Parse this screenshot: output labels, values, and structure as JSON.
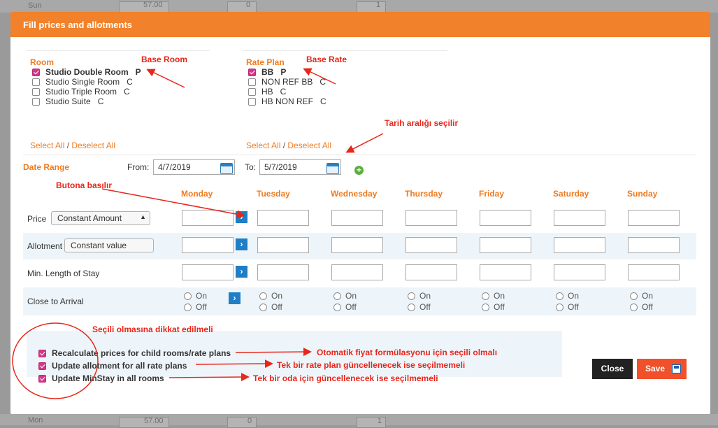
{
  "dialog": {
    "title": "Fill prices and allotments"
  },
  "background": {
    "top_day": "Sun",
    "top_price": "57.00",
    "top_count": "0",
    "top_qty": "1",
    "bottom_day": "Mon",
    "bottom_price": "57.00",
    "bottom_count": "0",
    "bottom_qty": "1"
  },
  "room": {
    "heading": "Room",
    "items": [
      {
        "label": "Studio Double Room",
        "code": "P",
        "checked": true
      },
      {
        "label": "Studio Single Room",
        "code": "C",
        "checked": false
      },
      {
        "label": "Studio Triple Room",
        "code": "C",
        "checked": false
      },
      {
        "label": "Studio Suite",
        "code": "C",
        "checked": false
      }
    ],
    "select_all": "Select All",
    "deselect_all": "Deselect All"
  },
  "rate_plan": {
    "heading": "Rate Plan",
    "items": [
      {
        "label": "BB",
        "code": "P",
        "checked": true
      },
      {
        "label": "NON REF BB",
        "code": "C",
        "checked": false
      },
      {
        "label": "HB",
        "code": "C",
        "checked": false
      },
      {
        "label": "HB NON REF",
        "code": "C",
        "checked": false
      }
    ],
    "select_all": "Select All",
    "deselect_all": "Deselect All"
  },
  "date_range": {
    "label": "Date Range",
    "from_label": "From:",
    "from_value": "4/7/2019",
    "to_label": "To:",
    "to_value": "5/7/2019"
  },
  "days": [
    "Monday",
    "Tuesday",
    "Wednesday",
    "Thursday",
    "Friday",
    "Saturday",
    "Sunday"
  ],
  "rows": {
    "price": {
      "label": "Price",
      "select": "Constant Amount"
    },
    "allotment": {
      "label": "Allotment",
      "select": "Constant value"
    },
    "min_stay": {
      "label": "Min. Length of Stay"
    },
    "cta": {
      "label": "Close to Arrival",
      "on": "On",
      "off": "Off"
    }
  },
  "options": [
    {
      "label": "Recalculate prices for child rooms/rate plans",
      "checked": true
    },
    {
      "label": "Update allotment for all rate plans",
      "checked": true
    },
    {
      "label": "Update MinStay in all rooms",
      "checked": true
    }
  ],
  "buttons": {
    "close": "Close",
    "save": "Save"
  },
  "annotations": {
    "base_room": "Base Room",
    "base_rate": "Base Rate",
    "date_note": "Tarih aralığı seçilir",
    "button_note": "Butona basılır",
    "attention": "Seçili olmasına dikkat edilmeli",
    "opt1_note": "Otomatik fiyat formülasyonu için seçili olmalı",
    "opt2_note": "Tek bir rate plan güncellenecek ise seçilmemeli",
    "opt3_note": "Tek bir oda için güncellenecek ise seçilmemeli"
  },
  "colors": {
    "header": "#f1812a",
    "accent": "#f07b20",
    "annotation": "#e8261a",
    "save": "#f0502a",
    "close": "#222222",
    "go_button": "#1e7fc6",
    "band": "#eef5fa"
  }
}
